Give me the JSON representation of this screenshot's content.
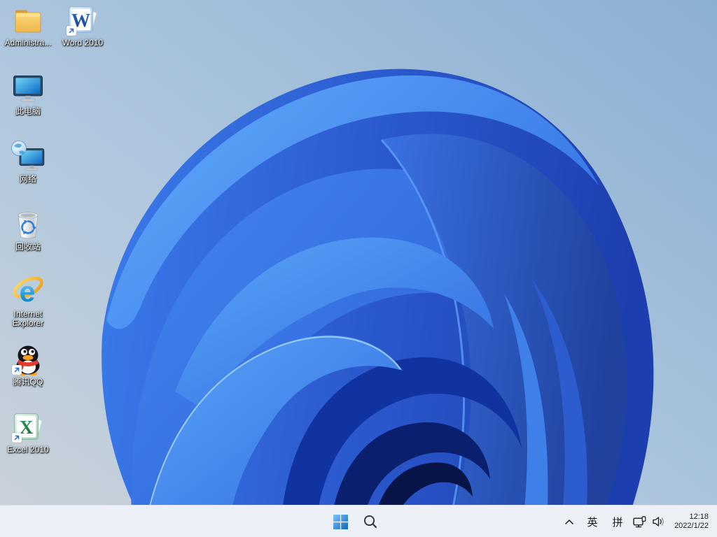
{
  "desktop": {
    "icons": [
      {
        "label": "Administra...",
        "type": "folder"
      },
      {
        "label": "Word 2010",
        "type": "word",
        "glyph": "W",
        "shortcut": true
      },
      {
        "label": "此电脑",
        "type": "this-pc"
      },
      {
        "label": "网络",
        "type": "network"
      },
      {
        "label": "回收站",
        "type": "recycle-bin"
      },
      {
        "label": "Internet Explorer",
        "type": "internet-explorer",
        "glyph": "e"
      },
      {
        "label": "腾讯QQ",
        "type": "tencent-qq",
        "shortcut": true
      },
      {
        "label": "Excel 2010",
        "type": "excel",
        "glyph": "X",
        "shortcut": true
      }
    ]
  },
  "taskbar": {
    "tray": {
      "ime_language": "英",
      "ime_mode": "拼",
      "time": "12:18",
      "date": "2022/1/22"
    }
  },
  "colors": {
    "taskbar_bg": "#edf0f6",
    "wallpaper_sky_top_right": "#8bafd3",
    "wallpaper_sky_bottom_left": "#cbd2d9",
    "bloom_bright_blue": "#58a3f8",
    "bloom_mid_blue": "#2c5fd6",
    "bloom_dark_blue": "#0a1f6e",
    "start_logo_blue": "#1b74d8"
  }
}
